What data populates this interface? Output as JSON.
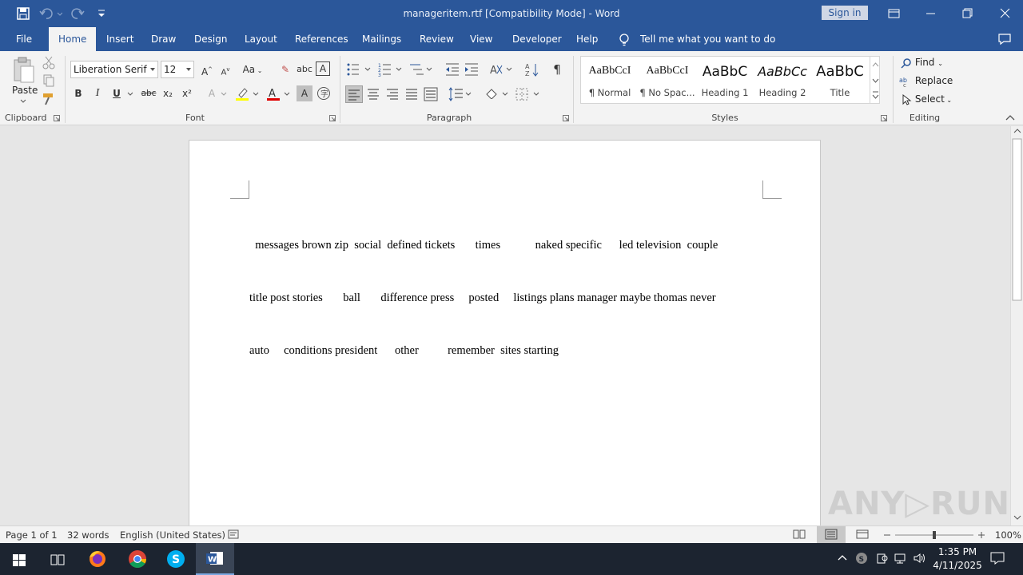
{
  "window": {
    "title": "manageritem.rtf [Compatibility Mode]  -  Word",
    "sign_in": "Sign in"
  },
  "tabs": [
    "File",
    "Home",
    "Insert",
    "Draw",
    "Design",
    "Layout",
    "References",
    "Mailings",
    "Review",
    "View",
    "Developer",
    "Help"
  ],
  "active_tab": "Home",
  "tell_me": "Tell me what you want to do",
  "ribbon": {
    "clipboard": {
      "paste": "Paste",
      "label": "Clipboard"
    },
    "font": {
      "family": "Liberation Serif",
      "size": "12",
      "label": "Font",
      "bold": "B",
      "italic": "I",
      "underline": "U",
      "strike": "abc",
      "subscript": "x₂",
      "superscript": "x²",
      "aa": "Aa"
    },
    "paragraph": {
      "label": "Paragraph"
    },
    "styles": {
      "label": "Styles",
      "items": [
        {
          "sample": "AaBbCcI",
          "name": "¶ Normal"
        },
        {
          "sample": "AaBbCcI",
          "name": "¶ No Spac..."
        },
        {
          "sample": "AaBbC",
          "name": "Heading 1"
        },
        {
          "sample": "AaBbCc",
          "name": "Heading 2"
        },
        {
          "sample": "AaBbC",
          "name": "Title"
        }
      ]
    },
    "editing": {
      "label": "Editing",
      "find": "Find",
      "replace": "Replace",
      "select": "Select"
    }
  },
  "document": {
    "lines": [
      "  messages brown zip  social  defined tickets       times            naked specific      led television  couple",
      "title post stories       ball       difference press     posted     listings plans manager maybe thomas never",
      "auto     conditions president      other          remember  sites starting"
    ]
  },
  "statusbar": {
    "page": "Page 1 of 1",
    "words": "32 words",
    "language": "English (United States)",
    "zoom": "100%"
  },
  "taskbar": {
    "time": "1:35 PM",
    "date": "4/11/2025"
  },
  "watermark": "ANY RUN",
  "colors": {
    "accent": "#2b579a",
    "taskbar": "#1c2430"
  }
}
